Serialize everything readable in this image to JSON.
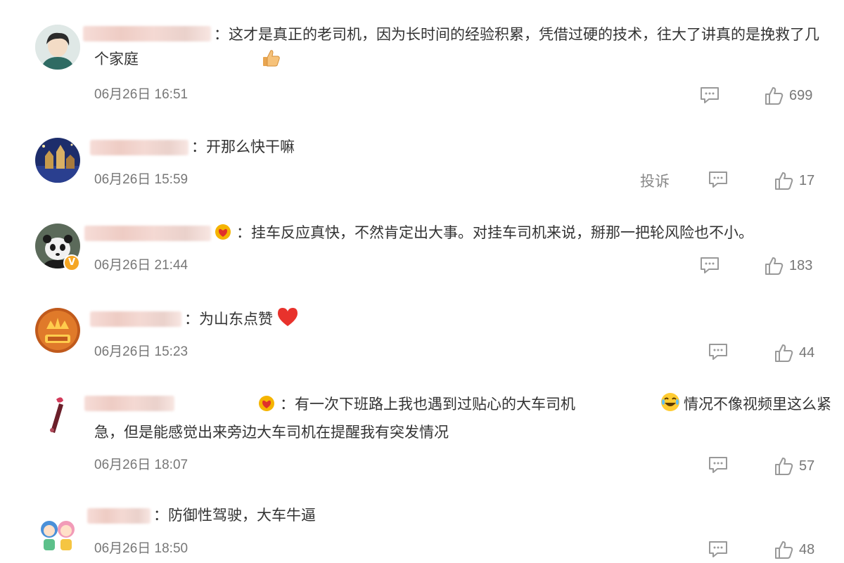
{
  "comments": [
    {
      "text": "：这才是真正的老司机，因为长时间的经验积累，凭借过硬的技术，往大了讲真的是挽救了几个家庭",
      "emoji": "thumbs-up-icon",
      "time": "06月26日 16:51",
      "likes": "699"
    },
    {
      "text": "：开那么快干嘛",
      "time": "06月26日 15:59",
      "report": "投诉",
      "likes": "17"
    },
    {
      "text": "：挂车反应真快，不然肯定出大事。对挂车司机来说，掰那一把轮风险也不小。",
      "badge": "V",
      "time": "06月26日 21:44",
      "likes": "183"
    },
    {
      "text": "：为山东点赞",
      "emoji": "heart-icon",
      "time": "06月26日 15:23",
      "likes": "44"
    },
    {
      "text_a": "：有一次下班路上我也遇到过贴心的大车司机",
      "text_b": "情况不像视频里这么紧急，但是能感觉出来旁边大车司机在提醒我有突发情况",
      "time": "06月26日 18:07",
      "likes": "57"
    },
    {
      "text": "：防御性驾驶，大车牛逼",
      "time": "06月26日 18:50",
      "likes": "48"
    }
  ],
  "colors": {
    "text": "#333333",
    "meta": "#777777",
    "name_blur": "#f0d2cb",
    "badge": "#f5a623"
  }
}
